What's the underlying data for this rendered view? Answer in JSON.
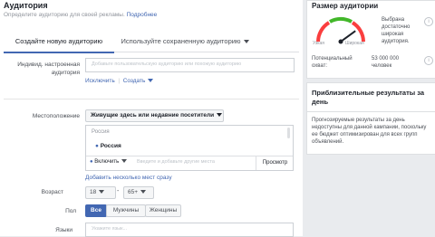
{
  "audience": {
    "title": "Аудитория",
    "subtitle": "Определите аудиторию для своей рекламы.",
    "more_link": "Подробнее"
  },
  "tabs": [
    {
      "label": "Создайте новую аудиторию",
      "active": true
    },
    {
      "label": "Используйте сохраненную аудиторию",
      "active": false
    }
  ],
  "custom_audience": {
    "label_line1": "Индивид. настроенная",
    "label_line2": "аудитория",
    "placeholder": "Добавьте пользовательскую аудиторию или похожую аудиторию",
    "exclude_link": "Исключить",
    "create_link": "Создать"
  },
  "location": {
    "label": "Местоположение",
    "mode": "Живущие здесь или недавние посетители",
    "country_header": "Россия",
    "selected": "Россия",
    "include": "Включить",
    "search_placeholder": "Введите и добавьте другие места",
    "browse": "Просмотр",
    "add_multiple": "Добавить несколько мест сразу"
  },
  "age": {
    "label": "Возраст",
    "from": "18",
    "to": "65+"
  },
  "gender": {
    "label": "Пол",
    "options": [
      "Все",
      "Мужчины",
      "Женщины"
    ],
    "selected": "Все"
  },
  "languages": {
    "label": "Языки",
    "placeholder": "Укажите язык..."
  },
  "audience_size": {
    "title": "Размер аудитории",
    "gauge_left": "Узкая",
    "gauge_right": "Широкая",
    "gauge_level": 0.8,
    "description": "Выбрана достаточно широкая аудитория.",
    "reach_label": "Потенциальный охват:",
    "reach_value": "53 000 000 человек"
  },
  "estimates": {
    "title": "Приблизительные результаты за день",
    "text": "Прогнозируемые результаты за день недоступны для данной кампании, поскольку ее бюджет оптимизирован для всех групп объявлений."
  },
  "colors": {
    "accent": "#4267b2",
    "gauge_green": "#42b72a",
    "gauge_red": "#fa3e3e"
  }
}
